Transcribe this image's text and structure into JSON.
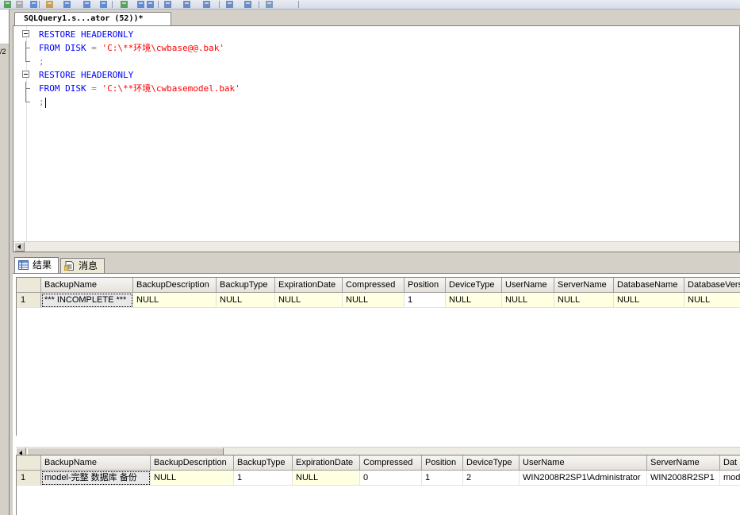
{
  "toolbar": {
    "icons": [
      "run-icon",
      "stop-icon",
      "parse-icon",
      "database-icon",
      "display-plan-icon",
      "results-to-grid-icon",
      "query-options-icon",
      "include-plan-icon",
      "results-to-text-icon",
      "results-to-file-icon",
      "comment-icon",
      "uncomment-icon",
      "decrease-indent-icon",
      "increase-indent-icon",
      "specify-values-icon",
      "toolbar-options-icon"
    ]
  },
  "left_panel": {
    "fragment": "/2"
  },
  "document_tab": {
    "title": "SQLQuery1.s...ator (52))*"
  },
  "editor": {
    "lines": [
      [
        {
          "text": "RESTORE HEADERONLY",
          "cls": "kw"
        }
      ],
      [
        {
          "text": "FROM DISK",
          "cls": "kw"
        },
        {
          "text": " = ",
          "cls": "gray"
        },
        {
          "text": "'C:\\**环境\\cwbase@@.bak'",
          "cls": "str"
        }
      ],
      [
        {
          "text": ";",
          "cls": "gray"
        }
      ],
      [
        {
          "text": "RESTORE HEADERONLY",
          "cls": "kw"
        }
      ],
      [
        {
          "text": "FROM DISK",
          "cls": "kw"
        },
        {
          "text": " = ",
          "cls": "gray"
        },
        {
          "text": "'C:\\**环境\\cwbasemodel.bak'",
          "cls": "str"
        }
      ],
      [
        {
          "text": ";",
          "cls": "gray"
        }
      ]
    ]
  },
  "results_tabs": [
    {
      "label": "结果",
      "icon": "grid-results-icon"
    },
    {
      "label": "消息",
      "icon": "messages-icon"
    }
  ],
  "grid1": {
    "columns": [
      "BackupName",
      "BackupDescription",
      "BackupType",
      "ExpirationDate",
      "Compressed",
      "Position",
      "DeviceType",
      "UserName",
      "ServerName",
      "DatabaseName",
      "DatabaseVersi"
    ],
    "rows": [
      {
        "num": "1",
        "cells": [
          "*** INCOMPLETE ***",
          "NULL",
          "NULL",
          "NULL",
          "NULL",
          "1",
          "NULL",
          "NULL",
          "NULL",
          "NULL",
          "NULL"
        ]
      }
    ]
  },
  "grid2": {
    "columns": [
      "BackupName",
      "BackupDescription",
      "BackupType",
      "ExpirationDate",
      "Compressed",
      "Position",
      "DeviceType",
      "UserName",
      "ServerName",
      "Dat"
    ],
    "rows": [
      {
        "num": "1",
        "cells": [
          "model-完整 数据库 备份",
          "NULL",
          "1",
          "NULL",
          "0",
          "1",
          "2",
          "WIN2008R2SP1\\Administrator",
          "WIN2008R2SP1",
          "mod"
        ]
      }
    ]
  }
}
